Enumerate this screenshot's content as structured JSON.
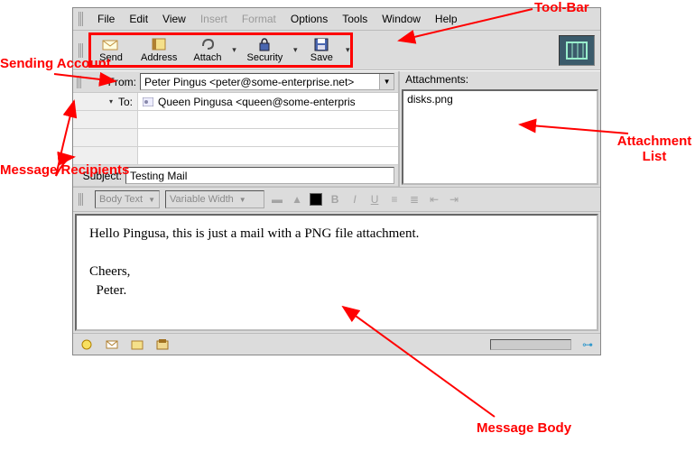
{
  "annotations": {
    "toolbar": "Tool-Bar",
    "sending_account": "Sending\nAccount",
    "message_recipients": "Message\nRecipients",
    "attachment_list": "Attachment\nList",
    "message_body": "Message\nBody"
  },
  "menu": {
    "file": "File",
    "edit": "Edit",
    "view": "View",
    "insert": "Insert",
    "format": "Format",
    "options": "Options",
    "tools": "Tools",
    "window": "Window",
    "help": "Help"
  },
  "toolbar": {
    "send": "Send",
    "address": "Address",
    "attach": "Attach",
    "security": "Security",
    "save": "Save"
  },
  "headers": {
    "from_label": "From:",
    "from_value": "Peter Pingus <peter@some-enterprise.net>",
    "to_label": "To:",
    "to_value": "Queen Pingusa <queen@some-enterpris",
    "subject_label": "Subject:",
    "subject_value": "Testing Mail"
  },
  "attachments": {
    "label": "Attachments:",
    "items": [
      "disks.png"
    ]
  },
  "formatbar": {
    "style": "Body Text",
    "font": "Variable Width"
  },
  "body": "Hello Pingusa, this is just a mail with a PNG file attachment.\n\nCheers,\n  Peter."
}
